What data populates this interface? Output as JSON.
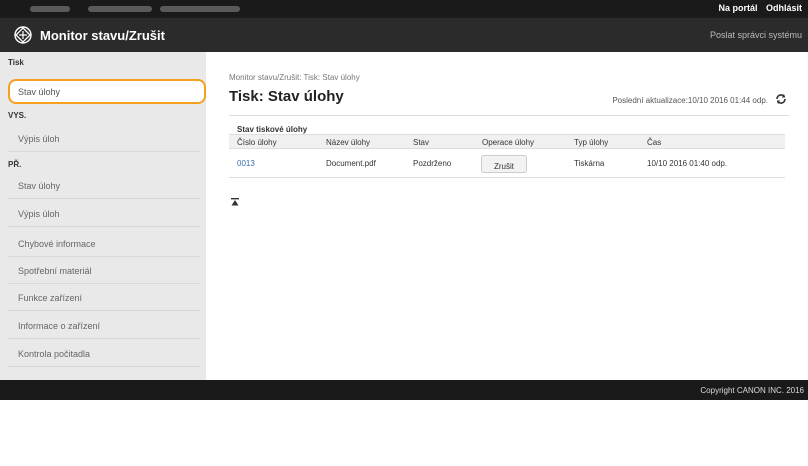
{
  "topbar": {
    "portal_link": "Na portál",
    "logout_link": "Odhlásit"
  },
  "header": {
    "title": "Monitor stavu/Zrušit",
    "sysadmin_link": "Poslat správci systému"
  },
  "sidebar": {
    "section_tisk": "Tisk",
    "tisk_items": [
      {
        "label": "Stav úlohy"
      }
    ],
    "section_vys": "VYS.",
    "vys_items": [
      {
        "label": "Výpis úloh"
      }
    ],
    "section_pr": "PŘ.",
    "pr_items": [
      {
        "label": "Stav úlohy"
      },
      {
        "label": "Výpis úloh"
      }
    ],
    "extra_items": [
      {
        "label": "Chybové informace"
      },
      {
        "label": "Spotřební materiál"
      },
      {
        "label": "Funkce zařízení"
      },
      {
        "label": "Informace o zařízení"
      },
      {
        "label": "Kontrola počitadla"
      }
    ]
  },
  "main": {
    "breadcrumb": "Monitor stavu/Zrušit: Tisk: Stav úlohy",
    "title": "Tisk: Stav úlohy",
    "last_update": "Poslední aktualizace:10/10 2016 01:44 odp.",
    "section_title": "Stav tiskové úlohy",
    "columns": [
      "Číslo úlohy",
      "Název úlohy",
      "Stav",
      "Operace úlohy",
      "Typ úlohy",
      "Čas"
    ],
    "rows": [
      {
        "job_no": "0013",
        "name": "Document.pdf",
        "status": "Pozdrženo",
        "op": "Zrušit",
        "type": "Tiskárna",
        "time": "10/10 2016 01:40 odp."
      }
    ]
  },
  "footer": {
    "copyright": "Copyright CANON INC. 2016"
  },
  "colors": {
    "accent_orange": "#f5a021",
    "link_blue": "#3a6fb0",
    "header_dark": "#2b2b2b"
  }
}
